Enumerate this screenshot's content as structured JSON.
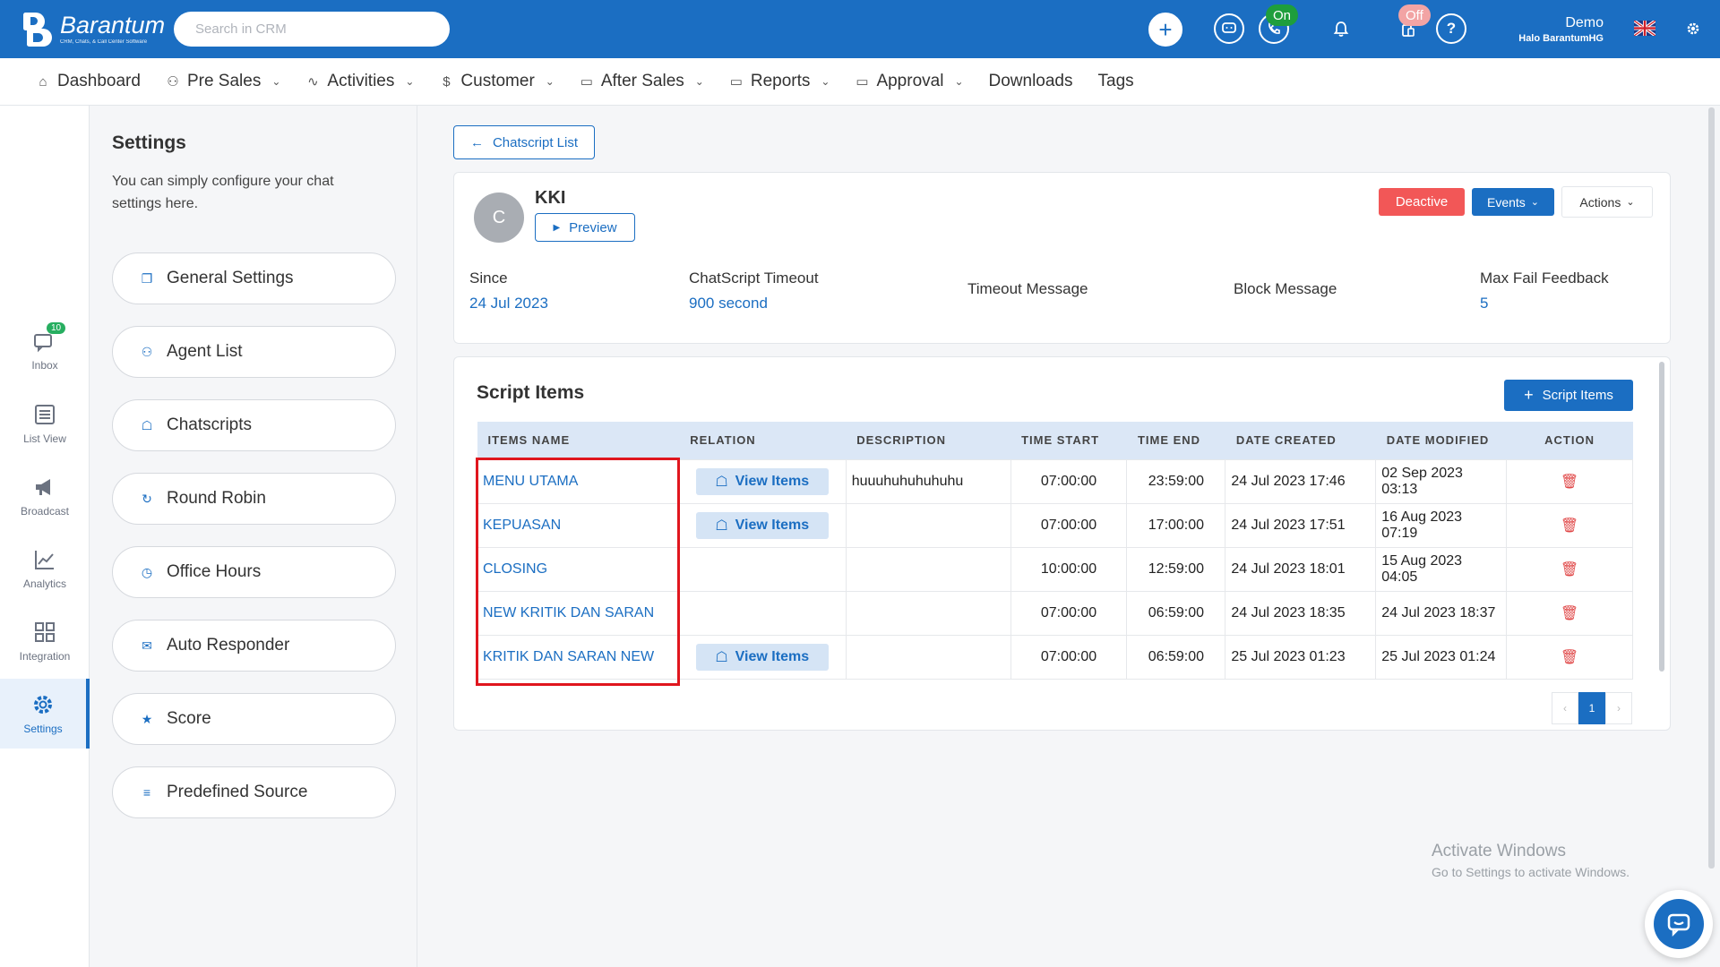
{
  "topbar": {
    "logo_name": "Barantum",
    "logo_tagline": "CRM, Chats, & Call Center Software",
    "search_placeholder": "Search in CRM",
    "phone_status": "On",
    "device_status": "Off",
    "user_name": "Demo",
    "user_org": "Halo BarantumHG",
    "icons": [
      "plus-icon",
      "chat-icon",
      "phone-icon",
      "bell-icon",
      "device-icon",
      "help-icon",
      "uk-flag-icon",
      "gear-icon"
    ]
  },
  "nav": {
    "items": [
      {
        "label": "Dashboard",
        "icon": "home-icon",
        "dropdown": false
      },
      {
        "label": "Pre Sales",
        "icon": "users-icon",
        "dropdown": true
      },
      {
        "label": "Activities",
        "icon": "activity-icon",
        "dropdown": true
      },
      {
        "label": "Customer",
        "icon": "dollar-icon",
        "dropdown": true
      },
      {
        "label": "After Sales",
        "icon": "folder-icon",
        "dropdown": true
      },
      {
        "label": "Reports",
        "icon": "folder-icon",
        "dropdown": true
      },
      {
        "label": "Approval",
        "icon": "folder-icon",
        "dropdown": true
      },
      {
        "label": "Downloads",
        "icon": "",
        "dropdown": false
      },
      {
        "label": "Tags",
        "icon": "",
        "dropdown": false
      }
    ]
  },
  "rail": {
    "items": [
      {
        "label": "Inbox",
        "badge": "10"
      },
      {
        "label": "List View"
      },
      {
        "label": "Broadcast"
      },
      {
        "label": "Analytics"
      },
      {
        "label": "Integration"
      },
      {
        "label": "Settings",
        "active": true
      }
    ]
  },
  "settings": {
    "title": "Settings",
    "description": "You can simply configure your chat settings here.",
    "items": [
      {
        "label": "General Settings"
      },
      {
        "label": "Agent List"
      },
      {
        "label": "Chatscripts"
      },
      {
        "label": "Round Robin"
      },
      {
        "label": "Office Hours"
      },
      {
        "label": "Auto Responder"
      },
      {
        "label": "Score"
      },
      {
        "label": "Predefined Source"
      }
    ]
  },
  "content": {
    "back_label": "Chatscript List",
    "script": {
      "avatar_letter": "C",
      "name": "KKI",
      "preview_label": "Preview",
      "deactive_label": "Deactive",
      "events_label": "Events",
      "actions_label": "Actions",
      "meta": [
        {
          "label": "Since",
          "value": "24 Jul 2023"
        },
        {
          "label": "ChatScript Timeout",
          "value": "900 second"
        },
        {
          "label": "Timeout Message",
          "value": ""
        },
        {
          "label": "Block Message",
          "value": ""
        },
        {
          "label": "Max Fail Feedback",
          "value": "5"
        }
      ]
    },
    "items_section": {
      "title": "Script Items",
      "add_label": "Script Items",
      "columns": [
        "ITEMS NAME",
        "RELATION",
        "DESCRIPTION",
        "TIME START",
        "TIME END",
        "DATE CREATED",
        "DATE MODIFIED",
        "ACTION"
      ],
      "view_items_label": "View Items",
      "rows": [
        {
          "name": "MENU UTAMA",
          "has_relation": true,
          "description": "huuuhuhuhuhuhu",
          "time_start": "07:00:00",
          "time_end": "23:59:00",
          "created": "24 Jul 2023 17:46",
          "modified": "02 Sep 2023 03:13"
        },
        {
          "name": "KEPUASAN",
          "has_relation": true,
          "description": "",
          "time_start": "07:00:00",
          "time_end": "17:00:00",
          "created": "24 Jul 2023 17:51",
          "modified": "16 Aug 2023 07:19"
        },
        {
          "name": "CLOSING",
          "has_relation": false,
          "description": "",
          "time_start": "10:00:00",
          "time_end": "12:59:00",
          "created": "24 Jul 2023 18:01",
          "modified": "15 Aug 2023 04:05"
        },
        {
          "name": "NEW KRITIK DAN SARAN",
          "has_relation": false,
          "description": "",
          "time_start": "07:00:00",
          "time_end": "06:59:00",
          "created": "24 Jul 2023 18:35",
          "modified": "24 Jul 2023 18:37"
        },
        {
          "name": "KRITIK DAN SARAN NEW",
          "has_relation": true,
          "description": "",
          "time_start": "07:00:00",
          "time_end": "06:59:00",
          "created": "25 Jul 2023 01:23",
          "modified": "25 Jul 2023 01:24"
        }
      ],
      "pagination": {
        "prev": "‹",
        "current": "1",
        "next": "›"
      }
    }
  },
  "watermark": {
    "line1": "Activate Windows",
    "line2": "Go to Settings to activate Windows."
  },
  "colors": {
    "primary": "#1b6ec2",
    "danger": "#f25757",
    "highlight": "#e0161e",
    "success": "#1e9e3c"
  }
}
